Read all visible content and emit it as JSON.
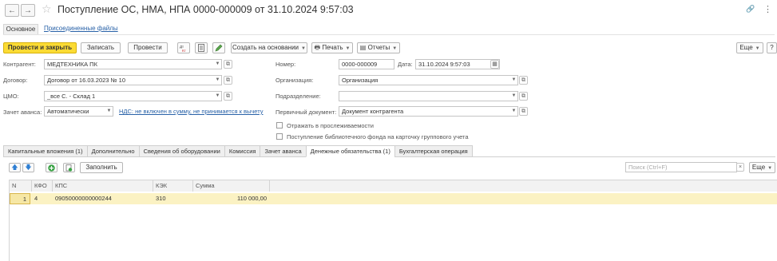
{
  "header": {
    "title": "Поступление ОС, НМА, НПА 0000-000009 от 31.10.2024 9:57:03",
    "back_glyph": "←",
    "forward_glyph": "→",
    "star_glyph": "☆",
    "link_glyph": "🔗",
    "more_glyph": "⋮"
  },
  "top_tabs": {
    "main": "Основное",
    "attached": "Присоединенные файлы"
  },
  "toolbar": {
    "post_close": "Провести и закрыть",
    "save": "Записать",
    "post": "Провести",
    "create_based": "Создать на основании",
    "print": "Печать",
    "reports": "Отчеты",
    "more": "Еще",
    "help": "?"
  },
  "form": {
    "counterparty_label": "Контрагент:",
    "counterparty_value": "МЕДТЕХНИКА ПК",
    "contract_label": "Договор:",
    "contract_value": "Договор от 16.03.2023 № 10",
    "cmo_label": "ЦМО:",
    "cmo_value": "_все С. - Склад 1",
    "advance_label": "Зачет аванса:",
    "advance_value": "Автоматически",
    "vat_link": "НДС: не включен в сумму, не принимается к вычету",
    "number_label": "Номер:",
    "number_value": "0000-000009",
    "date_label": "Дата:",
    "date_value": "31.10.2024  9:57:03",
    "org_label": "Организация:",
    "org_value": "Организация",
    "dept_label": "Подразделение:",
    "dept_value": "",
    "primary_doc_label": "Первичный документ:",
    "primary_doc_value": "Документ контрагента",
    "trace_label": "Отражать в прослеживаемости",
    "trace_checked": false,
    "library_label": "Поступление библиотечного фонда на карточку группового учета",
    "library_checked": false
  },
  "tabs": [
    "Капитальные вложения (1)",
    "Дополнительно",
    "Сведения об оборудовании",
    "Комиссия",
    "Зачет аванса",
    "Денежные обязательства (1)",
    "Бухгалтерская операция"
  ],
  "active_tab_index": 5,
  "table_toolbar": {
    "fill": "Заполнить",
    "search_placeholder": "Поиск (Ctrl+F)",
    "more": "Еще"
  },
  "table": {
    "columns": [
      "N",
      "КФО",
      "КПС",
      "КЭК",
      "Сумма"
    ],
    "rows": [
      {
        "n": "1",
        "kfo": "4",
        "kps": "09050000000000244",
        "kek": "310",
        "sum": "110 000,00"
      }
    ]
  },
  "colors": {
    "primary_button": "#fbdb34",
    "selected_row": "#fbf2c3",
    "link": "#2962a8"
  }
}
